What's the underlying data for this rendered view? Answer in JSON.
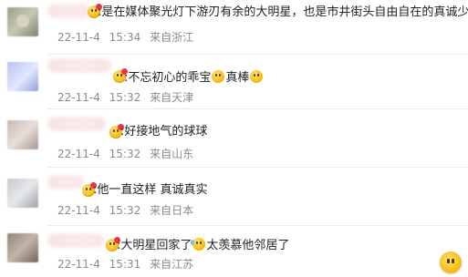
{
  "comments": [
    {
      "text": ":是在媒体聚光灯下游刃有余的大明星，也是市井街头自由自在的真诚少年",
      "date": "22-11-4",
      "time": "15:34",
      "location": "来自浙江"
    },
    {
      "text_a": ":不忘初心的乖宝",
      "text_b": "真棒",
      "date": "22-11-4",
      "time": "15:32",
      "location": "来自天津"
    },
    {
      "text": ":好接地气的球球",
      "date": "22-11-4",
      "time": "15:32",
      "location": "来自山东"
    },
    {
      "text": ":他一直这样  真诚真实",
      "date": "22-11-4",
      "time": "15:32",
      "location": "来自日本"
    },
    {
      "text_a": ":大明星回家了",
      "text_b": "太羡慕他邻居了",
      "date": "22-11-4",
      "time": "15:31",
      "location": "来自江苏"
    }
  ],
  "icons": {
    "name_emoji": "heart-eyes-emoji-icon",
    "inline_emoji": "smiling-emoji-icon",
    "sweat_emoji": "sweat-smile-emoji-icon",
    "floating_button": "emoji-reaction-icon"
  }
}
